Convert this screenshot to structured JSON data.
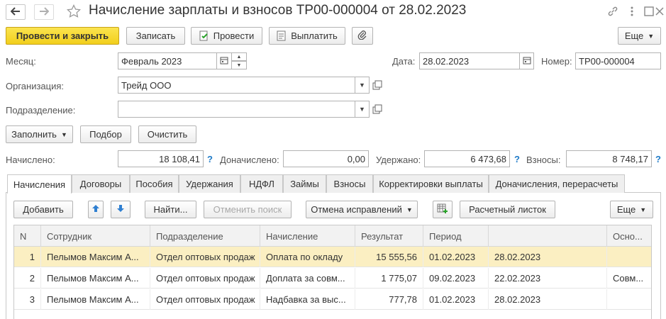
{
  "window": {
    "title": "Начисление зарплаты и взносов ТР00-000004 от 28.02.2023"
  },
  "toolbar": {
    "post_close": "Провести и закрыть",
    "save": "Записать",
    "post": "Провести",
    "pay": "Выплатить",
    "more": "Еще"
  },
  "form": {
    "month_label": "Месяц:",
    "month_value": "Февраль 2023",
    "date_label": "Дата:",
    "date_value": "28.02.2023",
    "number_label": "Номер:",
    "number_value": "ТР00-000004",
    "org_label": "Организация:",
    "org_value": "Трейд ООО",
    "dept_label": "Подразделение:",
    "dept_value": ""
  },
  "actions": {
    "fill": "Заполнить",
    "select": "Подбор",
    "clear": "Очистить"
  },
  "totals": {
    "accrued_label": "Начислено:",
    "accrued_value": "18 108,41",
    "extra_label": "Доначислено:",
    "extra_value": "0,00",
    "withheld_label": "Удержано:",
    "withheld_value": "6 473,68",
    "contrib_label": "Взносы:",
    "contrib_value": "8 748,17",
    "help": "?"
  },
  "tabs": [
    {
      "label": "Начисления",
      "active": true
    },
    {
      "label": "Договоры"
    },
    {
      "label": "Пособия"
    },
    {
      "label": "Удержания"
    },
    {
      "label": "НДФЛ"
    },
    {
      "label": "Займы"
    },
    {
      "label": "Взносы"
    },
    {
      "label": "Корректировки выплаты"
    },
    {
      "label": "Доначисления, перерасчеты"
    }
  ],
  "table_toolbar": {
    "add": "Добавить",
    "find": "Найти...",
    "cancel_search": "Отменить поиск",
    "cancel_fixes": "Отмена исправлений",
    "payslip": "Расчетный листок",
    "more": "Еще"
  },
  "table": {
    "columns": [
      "N",
      "Сотрудник",
      "Подразделение",
      "Начисление",
      "Результат",
      "Период",
      "",
      "Осно..."
    ],
    "rows": [
      {
        "n": "1",
        "employee": "Пелымов Максим А...",
        "dept": "Отдел оптовых продаж",
        "accrual": "Оплата по окладу",
        "result": "15 555,56",
        "from": "01.02.2023",
        "to": "28.02.2023",
        "basis": "",
        "selected": true
      },
      {
        "n": "2",
        "employee": "Пелымов Максим А...",
        "dept": "Отдел оптовых продаж",
        "accrual": "Доплата за совм...",
        "result": "1 775,07",
        "from": "09.02.2023",
        "to": "22.02.2023",
        "basis": "Совм..."
      },
      {
        "n": "3",
        "employee": "Пелымов Максим А...",
        "dept": "Отдел оптовых продаж",
        "accrual": "Надбавка за выс...",
        "result": "777,78",
        "from": "01.02.2023",
        "to": "28.02.2023",
        "basis": ""
      }
    ]
  }
}
